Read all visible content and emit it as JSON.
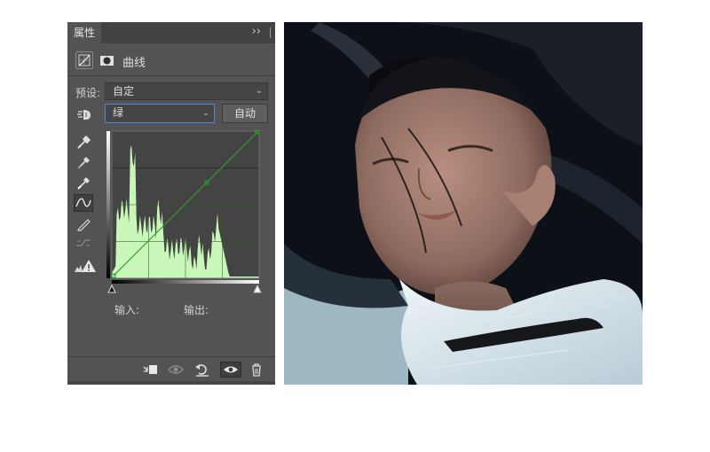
{
  "panel": {
    "tab_label": "属性",
    "collapse_label": "››",
    "title": "曲线",
    "preset_label": "预设:",
    "preset_value": "自定",
    "channel_value": "绿",
    "auto_label": "自动",
    "input_label": "输入:",
    "output_label": "输出:",
    "curve_color": "#2e9d2e",
    "histogram_color": "#c9f7b9"
  },
  "icons": {
    "adjustment": "curves-adjustment-icon",
    "mask": "mask-icon",
    "hand": "on-image-adjust-icon",
    "eyedroppers": [
      "black-point-eyedropper-icon",
      "gray-point-eyedropper-icon",
      "white-point-eyedropper-icon"
    ],
    "tools": [
      "curve-point-tool-icon",
      "pencil-tool-icon",
      "smooth-curve-icon",
      "clipping-warning-icon"
    ],
    "bottom": [
      "clip-to-layer-icon",
      "view-previous-state-icon",
      "reset-icon",
      "visibility-eye-icon",
      "delete-icon"
    ]
  }
}
